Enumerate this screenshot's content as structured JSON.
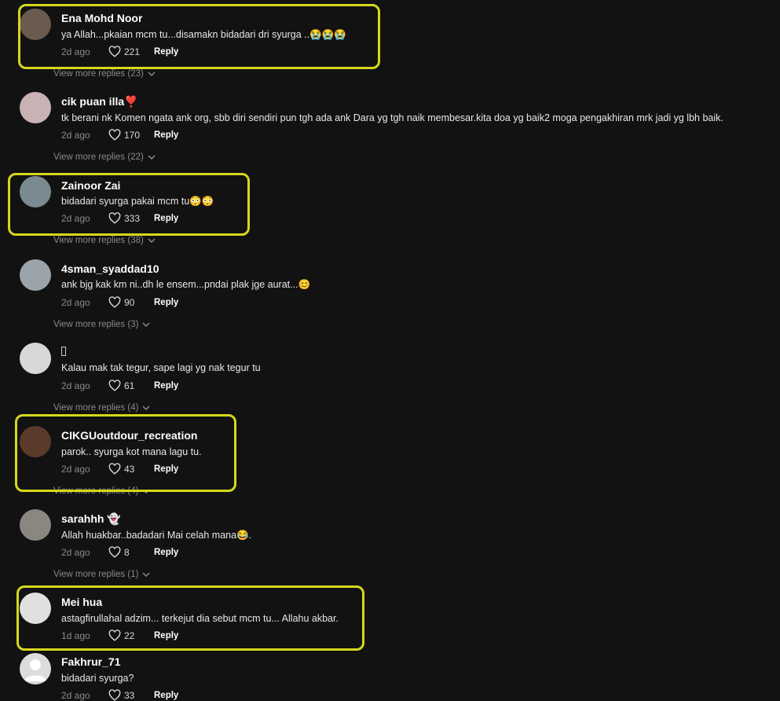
{
  "comments": [
    {
      "name": "Ena Mohd Noor",
      "text": "ya Allah...pkaian mcm tu...disamakn bidadari dri syurga ..😭😭😭",
      "time": "2d ago",
      "likes": "221",
      "reply": "Reply",
      "view_more": "View more replies (23)",
      "avatar_color": "#6b5a4e"
    },
    {
      "name": "cik puan illa❣️",
      "text": "tk berani nk Komen ngata ank org, sbb diri sendiri pun tgh ada ank Dara yg tgh naik membesar.kita doa yg baik2 moga pengakhiran mrk jadi yg lbh baik.",
      "time": "2d ago",
      "likes": "170",
      "reply": "Reply",
      "view_more": "View more replies (22)",
      "avatar_color": "#c9b2b4"
    },
    {
      "name": "Zainoor Zai",
      "text": "bidadari syurga pakai mcm tu😳😳",
      "time": "2d ago",
      "likes": "333",
      "reply": "Reply",
      "view_more": "View more replies (38)",
      "avatar_color": "#7a8a90"
    },
    {
      "name": "4sman_syaddad10",
      "text": "ank bjg kak km ni..dh le ensem...pndai plak jge aurat...😊",
      "time": "2d ago",
      "likes": "90",
      "reply": "Reply",
      "view_more": "View more replies (3)",
      "avatar_color": "#9aa4aa"
    },
    {
      "name": "",
      "text": "Kalau mak tak tegur, sape lagi yg nak tegur tu",
      "time": "2d ago",
      "likes": "61",
      "reply": "Reply",
      "view_more": "View more replies (4)",
      "avatar_color": "#d8d8d8"
    },
    {
      "name": "CIKGUoutdour_recreation",
      "text": "parok.. syurga kot mana lagu tu.",
      "time": "2d ago",
      "likes": "43",
      "reply": "Reply",
      "view_more": "View more replies (4)",
      "avatar_color": "#5a3a2a"
    },
    {
      "name": "sarahhh 👻",
      "text": "Allah huakbar..badadari Mai celah mana😂.",
      "time": "2d ago",
      "likes": "8",
      "reply": "Reply",
      "view_more": "View more replies (1)",
      "avatar_color": "#8a8680"
    },
    {
      "name": "Mei hua",
      "text": "astagfirullahal adzim... terkejut dia sebut mcm tu... Allahu akbar.",
      "time": "1d ago",
      "likes": "22",
      "reply": "Reply",
      "view_more": "",
      "avatar_color": "#e0e0e0"
    },
    {
      "name": "Fakhrur_71",
      "text": "bidadari syurga?",
      "time": "2d ago",
      "likes": "33",
      "reply": "Reply",
      "view_more": "",
      "avatar_color": "#dcdcdc"
    }
  ],
  "highlight_color": "#d4d81b"
}
